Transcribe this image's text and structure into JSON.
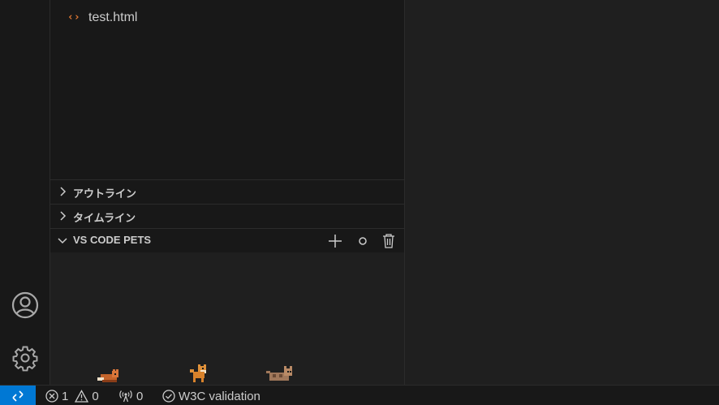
{
  "explorer": {
    "file_name": "test.html"
  },
  "sections": {
    "outline": "アウトライン",
    "timeline": "タイムライン",
    "pets": "VS CODE PETS"
  },
  "statusbar": {
    "errors": "1",
    "warnings": "0",
    "ports": "0",
    "w3c": "W3C validation"
  },
  "colors": {
    "accent": "#0078d4",
    "html_icon": "#e37933",
    "background": "#1f1f1f",
    "sidebar": "#181818"
  },
  "pets": [
    "fox",
    "dog",
    "cat"
  ]
}
